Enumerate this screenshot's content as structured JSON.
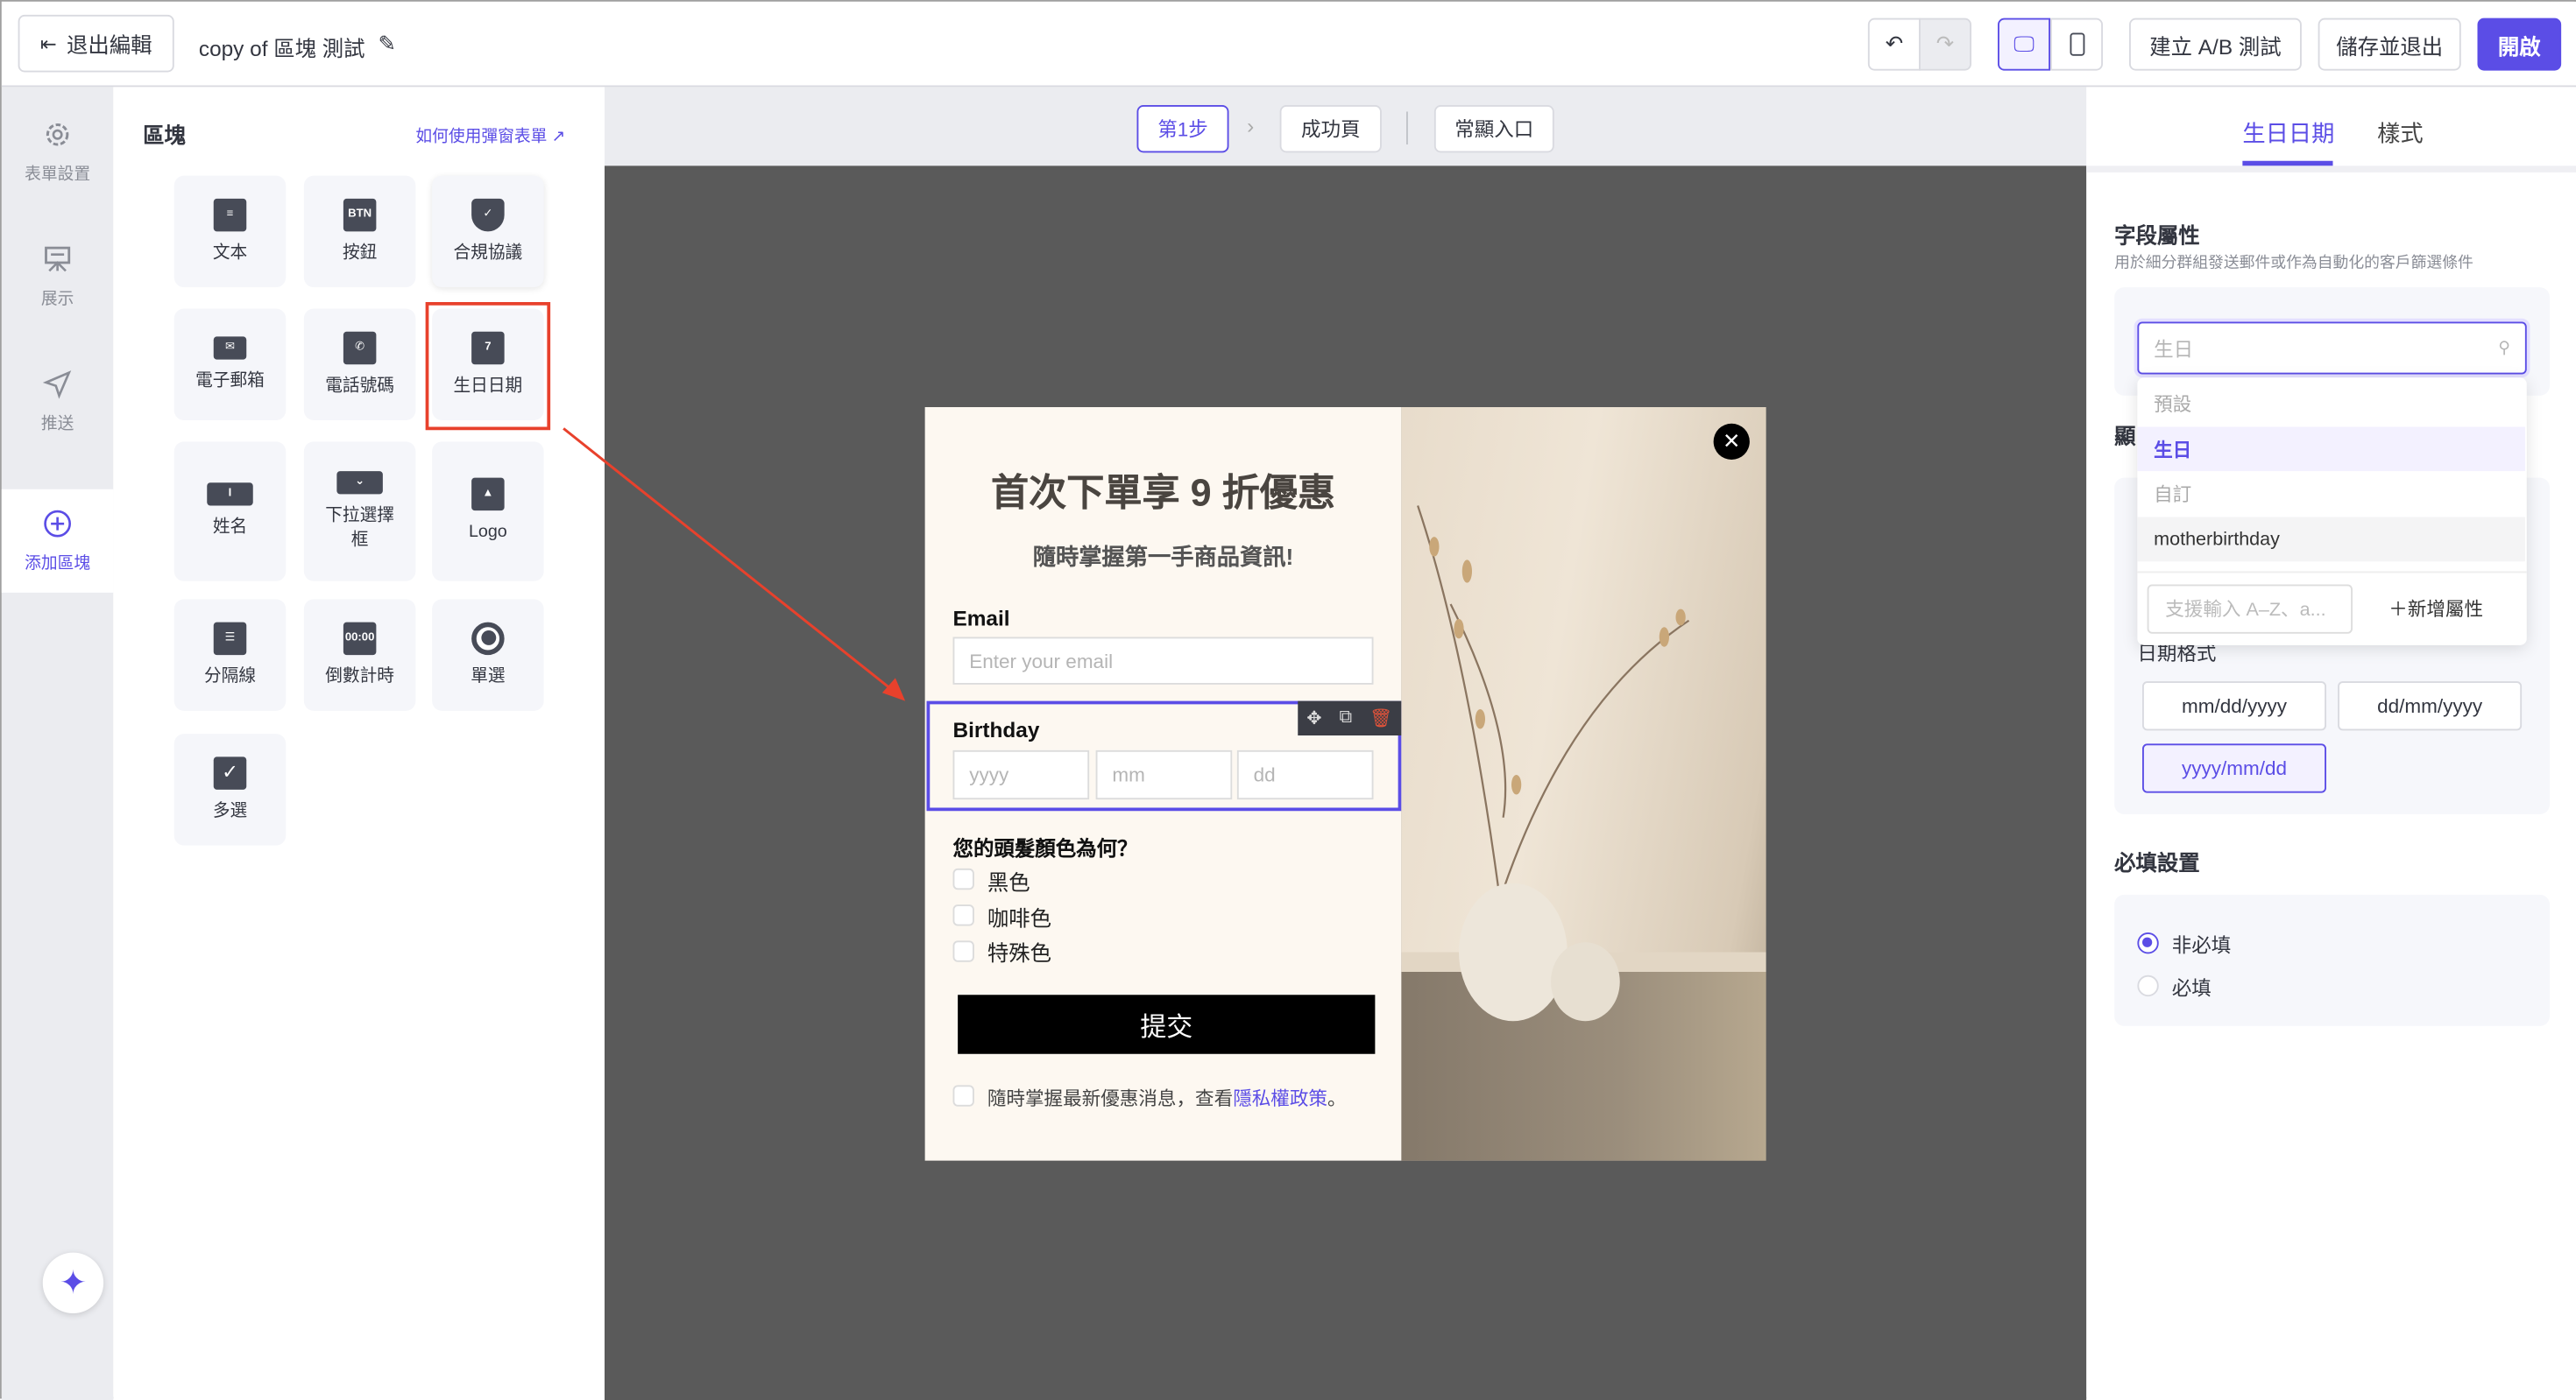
{
  "topbar": {
    "exit_label": "退出編輯",
    "title": "copy of 區塊 測試",
    "ab_test": "建立 A/B 測試",
    "save_exit": "儲存並退出",
    "open": "開啟"
  },
  "rail": {
    "items": [
      {
        "label": "表單設置"
      },
      {
        "label": "展示"
      },
      {
        "label": "推送"
      },
      {
        "label": "添加區塊"
      }
    ]
  },
  "blocks": {
    "title": "區塊",
    "help_link": "如何使用彈窗表單",
    "tiles": [
      {
        "label": "文本"
      },
      {
        "label": "按鈕",
        "icon_text": "BTN"
      },
      {
        "label": "合規協議"
      },
      {
        "label": "電子郵箱"
      },
      {
        "label": "電話號碼"
      },
      {
        "label": "生日日期"
      },
      {
        "label": "姓名"
      },
      {
        "label": "下拉選擇框"
      },
      {
        "label": "Logo"
      },
      {
        "label": "分隔線"
      },
      {
        "label": "倒數計時",
        "icon_text": "00:00"
      },
      {
        "label": "單選"
      },
      {
        "label": "多選"
      }
    ]
  },
  "steps": {
    "step1": "第1步",
    "success": "成功頁",
    "teaser": "常顯入口"
  },
  "popup": {
    "headline": "首次下單享 9 折優惠",
    "subhead": "隨時掌握第一手商品資訊!",
    "email_label": "Email",
    "email_placeholder": "Enter your email",
    "birthday_label": "Birthday",
    "yyyy": "yyyy",
    "mm": "mm",
    "dd": "dd",
    "question": "您的頭髮顏色為何？",
    "options": [
      "黑色",
      "咖啡色",
      "特殊色"
    ],
    "submit": "提交",
    "consent_text": "隨時掌握最新優惠消息，查看",
    "privacy_link": "隱私權政策",
    "consent_end": "。"
  },
  "right": {
    "tabs": [
      "生日日期",
      "樣式"
    ],
    "field_title": "字段屬性",
    "field_desc": "用於細分群組發送郵件或作為自動化的客戶篩選條件",
    "search_placeholder": "生日",
    "dropdown": {
      "group_default": "預設",
      "selected": "生日",
      "group_custom": "自訂",
      "custom_item": "motherbirthday",
      "new_placeholder": "支援輸入 A–Z、a...",
      "add_label": "新增屬性"
    },
    "hidden_heading": "顯",
    "date_format_label": "日期格式",
    "formats": [
      "mm/dd/yyyy",
      "dd/mm/yyyy",
      "yyyy/mm/dd"
    ],
    "selected_format": "yyyy/mm/dd",
    "required_title": "必填設置",
    "required_options": [
      "非必填",
      "必填"
    ],
    "required_selected": "非必填"
  },
  "colors": {
    "accent": "#5b4de6",
    "annotation": "#e8412c"
  }
}
